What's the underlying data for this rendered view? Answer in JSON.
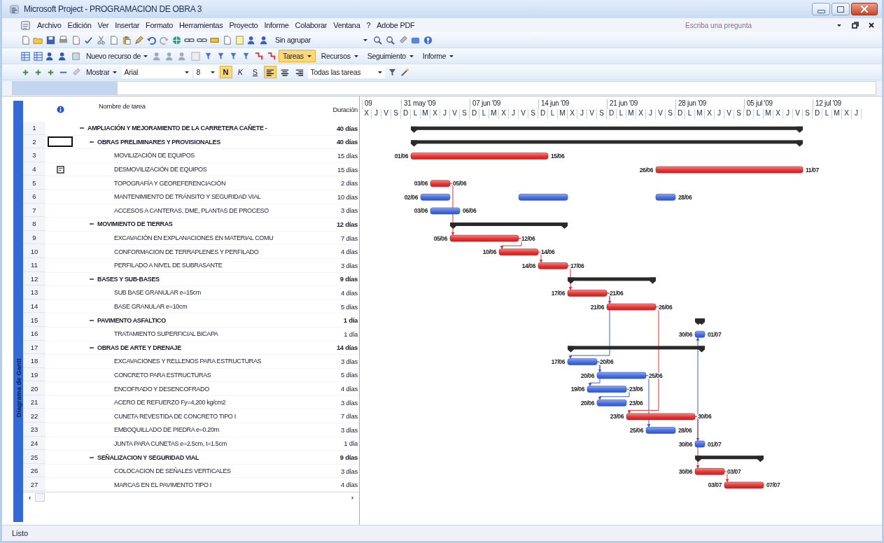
{
  "window": {
    "title": "Microsoft Project - PROGRAMACION DE OBRA 3"
  },
  "menu": [
    "Archivo",
    "Edición",
    "Ver",
    "Insertar",
    "Formato",
    "Herramientas",
    "Proyecto",
    "Informe",
    "Colaborar",
    "Ventana",
    "?",
    "Adobe PDF"
  ],
  "help_field": {
    "placeholder": "Escriba una pregunta"
  },
  "standard_toolbar": {
    "group_dropdown": "Sin agrupar"
  },
  "resource_toolbar": {
    "new_resource": "Nuevo recurso de",
    "guides": [
      {
        "label": "Tareas",
        "selected": true
      },
      {
        "label": "Recursos",
        "selected": false
      },
      {
        "label": "Seguimiento",
        "selected": false
      },
      {
        "label": "Informe",
        "selected": false
      }
    ]
  },
  "format_toolbar": {
    "show": "Mostrar",
    "font": "Arial",
    "size": "8",
    "styles": [
      {
        "label": "N",
        "kind": "bold",
        "on": true
      },
      {
        "label": "K",
        "kind": "italic",
        "on": false
      },
      {
        "label": "S",
        "kind": "underline",
        "on": false
      }
    ],
    "align_buttons": [
      {
        "selected": true
      },
      {
        "selected": false
      },
      {
        "selected": false
      }
    ],
    "filter": "Todas las tareas"
  },
  "side_tab": "Diagrama de Gantt",
  "table": {
    "columns": {
      "name": "Nombre de tarea",
      "duration": "Duración"
    },
    "rows": [
      {
        "id": "1",
        "name": "AMPLIACIÓN Y MEJORAMIENTO DE LA CARRETERA CAÑETE -",
        "duration": "40 días",
        "selected": false,
        "note": false,
        "expanded": true,
        "kind": "summary",
        "children": [
          {
            "id": "2",
            "name": "OBRAS PRELIMINARES Y PROVISIONALES",
            "duration": "40 días",
            "selected": true,
            "note": false,
            "expanded": true,
            "kind": "summary",
            "children": [
              {
                "id": "3",
                "name": "MOVILIZACIÓN DE EQUIPOS",
                "duration": "15 días",
                "selected": false,
                "note": false,
                "kind": "critical",
                "start_label": "01/06",
                "end_label": "15/06"
              },
              {
                "id": "4",
                "name": "DESMOVILIZACIÓN DE EQUIPOS",
                "duration": "15 días",
                "selected": false,
                "note": true,
                "kind": "critical",
                "start_label": "26/06",
                "end_label": "11/07"
              },
              {
                "id": "5",
                "name": "TOPOGRAFÍA Y GEOREFERENCIACIÓN",
                "duration": "2 días",
                "selected": false,
                "note": false,
                "kind": "critical",
                "start_label": "03/06",
                "end_label": "05/06"
              },
              {
                "id": "6",
                "name": "MANTENIMIENTO DE TRÁNSITO Y SEGURIDAD VIAL",
                "duration": "10 días",
                "selected": false,
                "note": false,
                "kind": "split",
                "start_label": "02/06",
                "end_label": "28/06"
              },
              {
                "id": "7",
                "name": "ACCESOS A CANTERAS, DME, PLANTAS DE PROCESO",
                "duration": "3 días",
                "selected": false,
                "note": false,
                "kind": "task",
                "start_label": "03/06",
                "end_label": "06/06"
              }
            ]
          },
          {
            "id": "8",
            "name": "MOVIMIENTO DE TIERRAS",
            "duration": "12 días",
            "selected": false,
            "note": false,
            "expanded": true,
            "kind": "summary",
            "children": [
              {
                "id": "9",
                "name": "EXCAVACIÓN EN EXPLANACIONES EN MATERIAL COMU",
                "duration": "7 días",
                "selected": false,
                "note": false,
                "kind": "critical",
                "start_label": "05/06",
                "end_label": "12/06"
              },
              {
                "id": "10",
                "name": "CONFORMACION DE TERRAPLENES Y PERFILADO",
                "duration": "4 días",
                "selected": false,
                "note": false,
                "kind": "critical",
                "start_label": "10/06",
                "end_label": "14/06"
              },
              {
                "id": "11",
                "name": "PERFILADO A NIVEL DE SUBRASANTE",
                "duration": "3 días",
                "selected": false,
                "note": false,
                "kind": "critical",
                "start_label": "14/06",
                "end_label": "17/06"
              }
            ]
          },
          {
            "id": "12",
            "name": "BASES Y SUB-BASES",
            "duration": "9 días",
            "selected": false,
            "note": false,
            "expanded": true,
            "kind": "summary",
            "children": [
              {
                "id": "13",
                "name": "SUB BASE GRANULAR e=15cm",
                "duration": "4 días",
                "selected": false,
                "note": false,
                "kind": "critical",
                "start_label": "17/06",
                "end_label": "21/06"
              },
              {
                "id": "14",
                "name": "BASE GRANULAR e=10cm",
                "duration": "5 días",
                "selected": false,
                "note": false,
                "kind": "critical",
                "start_label": "21/06",
                "end_label": "26/06"
              }
            ]
          },
          {
            "id": "15",
            "name": "PAVIMENTO ASFALTICO",
            "duration": "1 día",
            "selected": false,
            "note": false,
            "expanded": true,
            "kind": "summary",
            "children": [
              {
                "id": "16",
                "name": "TRATAMIENTO SUPERFICIAL BICAPA",
                "duration": "1 día",
                "selected": false,
                "note": false,
                "kind": "task",
                "start_label": "30/06",
                "end_label": "01/07"
              }
            ]
          },
          {
            "id": "17",
            "name": "OBRAS DE ARTE Y DRENAJE",
            "duration": "14 días",
            "selected": false,
            "note": false,
            "expanded": true,
            "kind": "summary",
            "children": [
              {
                "id": "18",
                "name": "EXCAVACIONES Y RELLENOS PARA ESTRUCTURAS",
                "duration": "3 días",
                "selected": false,
                "note": false,
                "kind": "task",
                "start_label": "17/06",
                "end_label": "20/06"
              },
              {
                "id": "19",
                "name": "CONCRETO PARA ESTRUCTURAS",
                "duration": "5 días",
                "selected": false,
                "note": false,
                "kind": "task",
                "start_label": "20/06",
                "end_label": "25/06"
              },
              {
                "id": "20",
                "name": "ENCOFRADO Y DESENCOFRADO",
                "duration": "4 días",
                "selected": false,
                "note": false,
                "kind": "task",
                "start_label": "19/06",
                "end_label": "23/06"
              },
              {
                "id": "21",
                "name": "ACERO DE REFUERZO Fy=4,200 kg/cm2",
                "duration": "3 días",
                "selected": false,
                "note": false,
                "kind": "task",
                "start_label": "20/06",
                "end_label": "23/06"
              },
              {
                "id": "22",
                "name": "CUNETA REVESTIDA DE CONCRETO TIPO I",
                "duration": "7 días",
                "selected": false,
                "note": false,
                "kind": "critical",
                "start_label": "23/06",
                "end_label": "30/06"
              },
              {
                "id": "23",
                "name": "EMBOQUILLADO DE PIEDRA e=0.20m",
                "duration": "3 días",
                "selected": false,
                "note": false,
                "kind": "task",
                "start_label": "25/06",
                "end_label": "28/06"
              },
              {
                "id": "24",
                "name": "JUNTA PARA CUNETAS e=2.5cm, t=1.5cm",
                "duration": "1 día",
                "selected": false,
                "note": false,
                "kind": "task",
                "start_label": "30/06",
                "end_label": "01/07"
              }
            ]
          },
          {
            "id": "25",
            "name": "SEÑALIZACION Y SEGURIDAD VIAL",
            "duration": "9 días",
            "selected": false,
            "note": false,
            "expanded": true,
            "kind": "summary",
            "children": [
              {
                "id": "26",
                "name": "COLOCACION DE SEÑALES VERTICALES",
                "duration": "3 días",
                "selected": false,
                "note": false,
                "kind": "critical",
                "start_label": "30/06",
                "end_label": "03/07"
              },
              {
                "id": "27",
                "name": "MARCAS EN EL PAVIMENTO TIPO I",
                "duration": "4 días",
                "selected": false,
                "note": false,
                "kind": "critical",
                "start_label": "03/07",
                "end_label": "07/07"
              }
            ]
          }
        ]
      }
    ]
  },
  "gantt": {
    "weeks": [
      {
        "label": "09",
        "days": [
          "X",
          "J",
          "V",
          "S"
        ]
      },
      {
        "label": "31 may '09",
        "days": [
          "D",
          "L",
          "M",
          "X",
          "J",
          "V",
          "S"
        ]
      },
      {
        "label": "07 jun '09",
        "days": [
          "D",
          "L",
          "M",
          "X",
          "J",
          "V",
          "S"
        ]
      },
      {
        "label": "14 jun '09",
        "days": [
          "D",
          "L",
          "M",
          "X",
          "J",
          "V",
          "S"
        ]
      },
      {
        "label": "21 jun '09",
        "days": [
          "D",
          "L",
          "M",
          "X",
          "J",
          "V",
          "S"
        ]
      },
      {
        "label": "28 jun '09",
        "days": [
          "D",
          "L",
          "M",
          "X",
          "J",
          "V",
          "S"
        ]
      },
      {
        "label": "05 jul '09",
        "days": [
          "D",
          "L",
          "M",
          "X",
          "J",
          "V",
          "S"
        ]
      },
      {
        "label": "12 jul '09",
        "days": [
          "D",
          "L",
          "M",
          "X",
          "J"
        ]
      }
    ]
  },
  "status_bar": {
    "text": "Listo"
  }
}
